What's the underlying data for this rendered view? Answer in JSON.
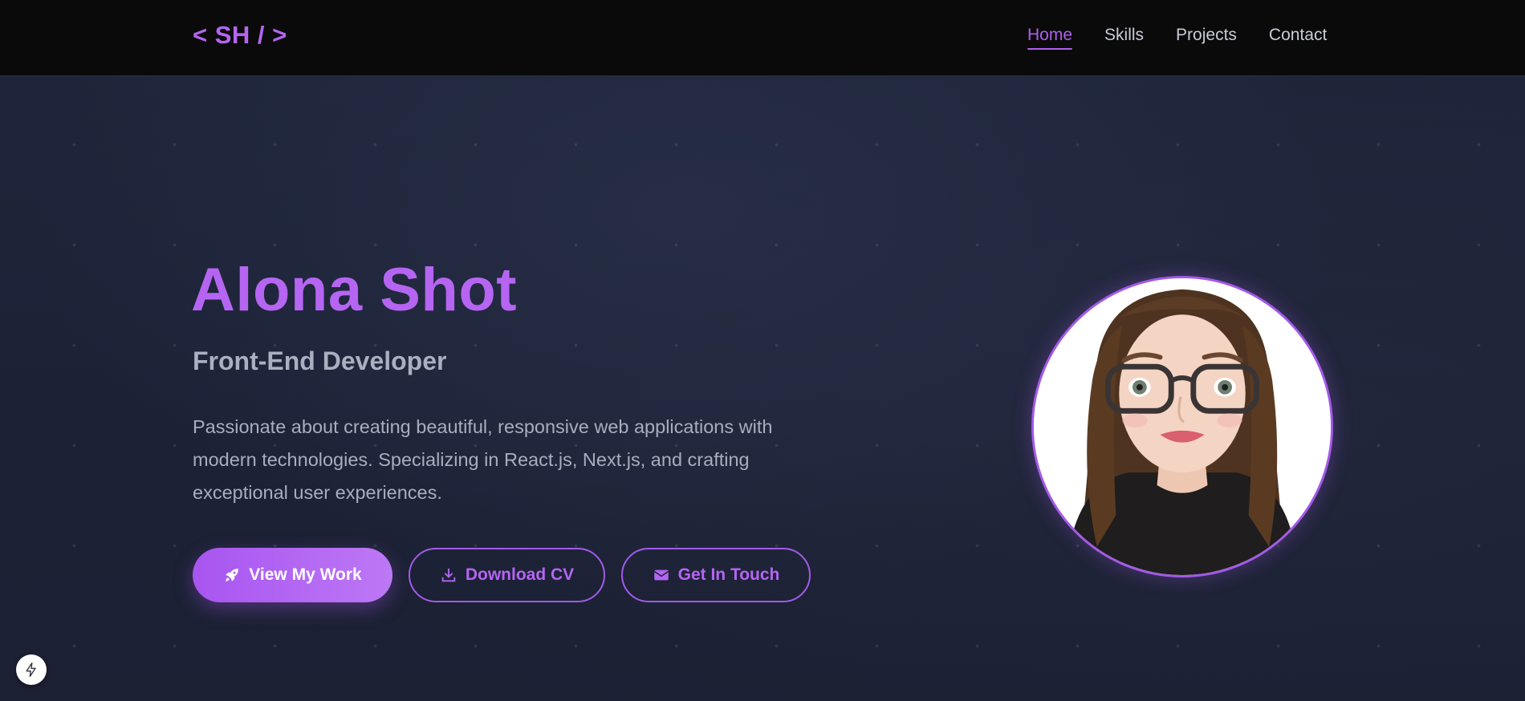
{
  "nav": {
    "logo": "< SH / >",
    "links": [
      {
        "label": "Home",
        "active": true
      },
      {
        "label": "Skills",
        "active": false
      },
      {
        "label": "Projects",
        "active": false
      },
      {
        "label": "Contact",
        "active": false
      }
    ]
  },
  "hero": {
    "name": "Alona Shot",
    "role": "Front-End Developer",
    "description": "Passionate about creating beautiful, responsive web applications with modern technologies. Specializing in React.js, Next.js, and crafting exceptional user experiences.",
    "buttons": {
      "view_work": {
        "label": "View My Work",
        "icon": "rocket-icon"
      },
      "download_cv": {
        "label": "Download CV",
        "icon": "download-icon"
      },
      "get_in_touch": {
        "label": "Get In Touch",
        "icon": "envelope-icon"
      }
    },
    "avatar_icon": "avatar-illustration"
  },
  "floating_badge_icon": "lightning-bolt-icon",
  "colors": {
    "accent": "#b565f2",
    "nav_bg": "#0a0a0b",
    "page_bg": "#1c2236",
    "text_muted": "#a8aebd"
  }
}
